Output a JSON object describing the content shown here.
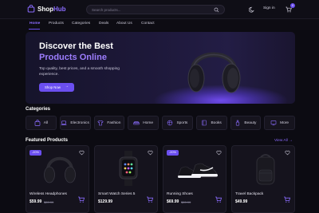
{
  "brand": {
    "name_part1": "Shop",
    "name_part2": "Hub",
    "accent": "#8b6cff"
  },
  "header": {
    "search_placeholder": "Search products...",
    "sign_in_label": "Sign in",
    "cart_count": "0",
    "icons": [
      "bag-icon",
      "search-icon",
      "moon-icon",
      "cart-icon"
    ]
  },
  "nav": {
    "items": [
      {
        "label": "Home",
        "active": true
      },
      {
        "label": "Products"
      },
      {
        "label": "Categories"
      },
      {
        "label": "Deals"
      },
      {
        "label": "About Us"
      },
      {
        "label": "Contact"
      }
    ]
  },
  "hero": {
    "title_line1": "Discover the Best",
    "title_line2": "Products Online",
    "subtitle": "Top quality, best prices, and a smooth shopping experience.",
    "button_label": "Shop Now",
    "slide_count": 4,
    "active_slide": 1
  },
  "categories": {
    "title": "Categories",
    "items": [
      {
        "label": "All",
        "icon": "bag-icon"
      },
      {
        "label": "Electronics",
        "icon": "laptop-icon"
      },
      {
        "label": "Fashion",
        "icon": "shirt-icon"
      },
      {
        "label": "Home",
        "icon": "sofa-icon"
      },
      {
        "label": "Sports",
        "icon": "ball-icon"
      },
      {
        "label": "Books",
        "icon": "book-icon"
      },
      {
        "label": "Beauty",
        "icon": "bottle-icon"
      },
      {
        "label": "More",
        "icon": "grid-icon"
      }
    ]
  },
  "featured": {
    "title": "Featured Products",
    "view_all_label": "View All",
    "products": [
      {
        "name": "Wireless Headphones",
        "price": "$59.99",
        "old_price": "$89.99",
        "badge": "-20%"
      },
      {
        "name": "Smart Watch Series 5",
        "price": "$129.99",
        "old_price": "",
        "badge": ""
      },
      {
        "name": "Running Shoes",
        "price": "$69.99",
        "old_price": "$89.99",
        "badge": "-20%"
      },
      {
        "name": "Travel Backpack",
        "price": "$49.99",
        "old_price": "",
        "badge": ""
      }
    ]
  }
}
